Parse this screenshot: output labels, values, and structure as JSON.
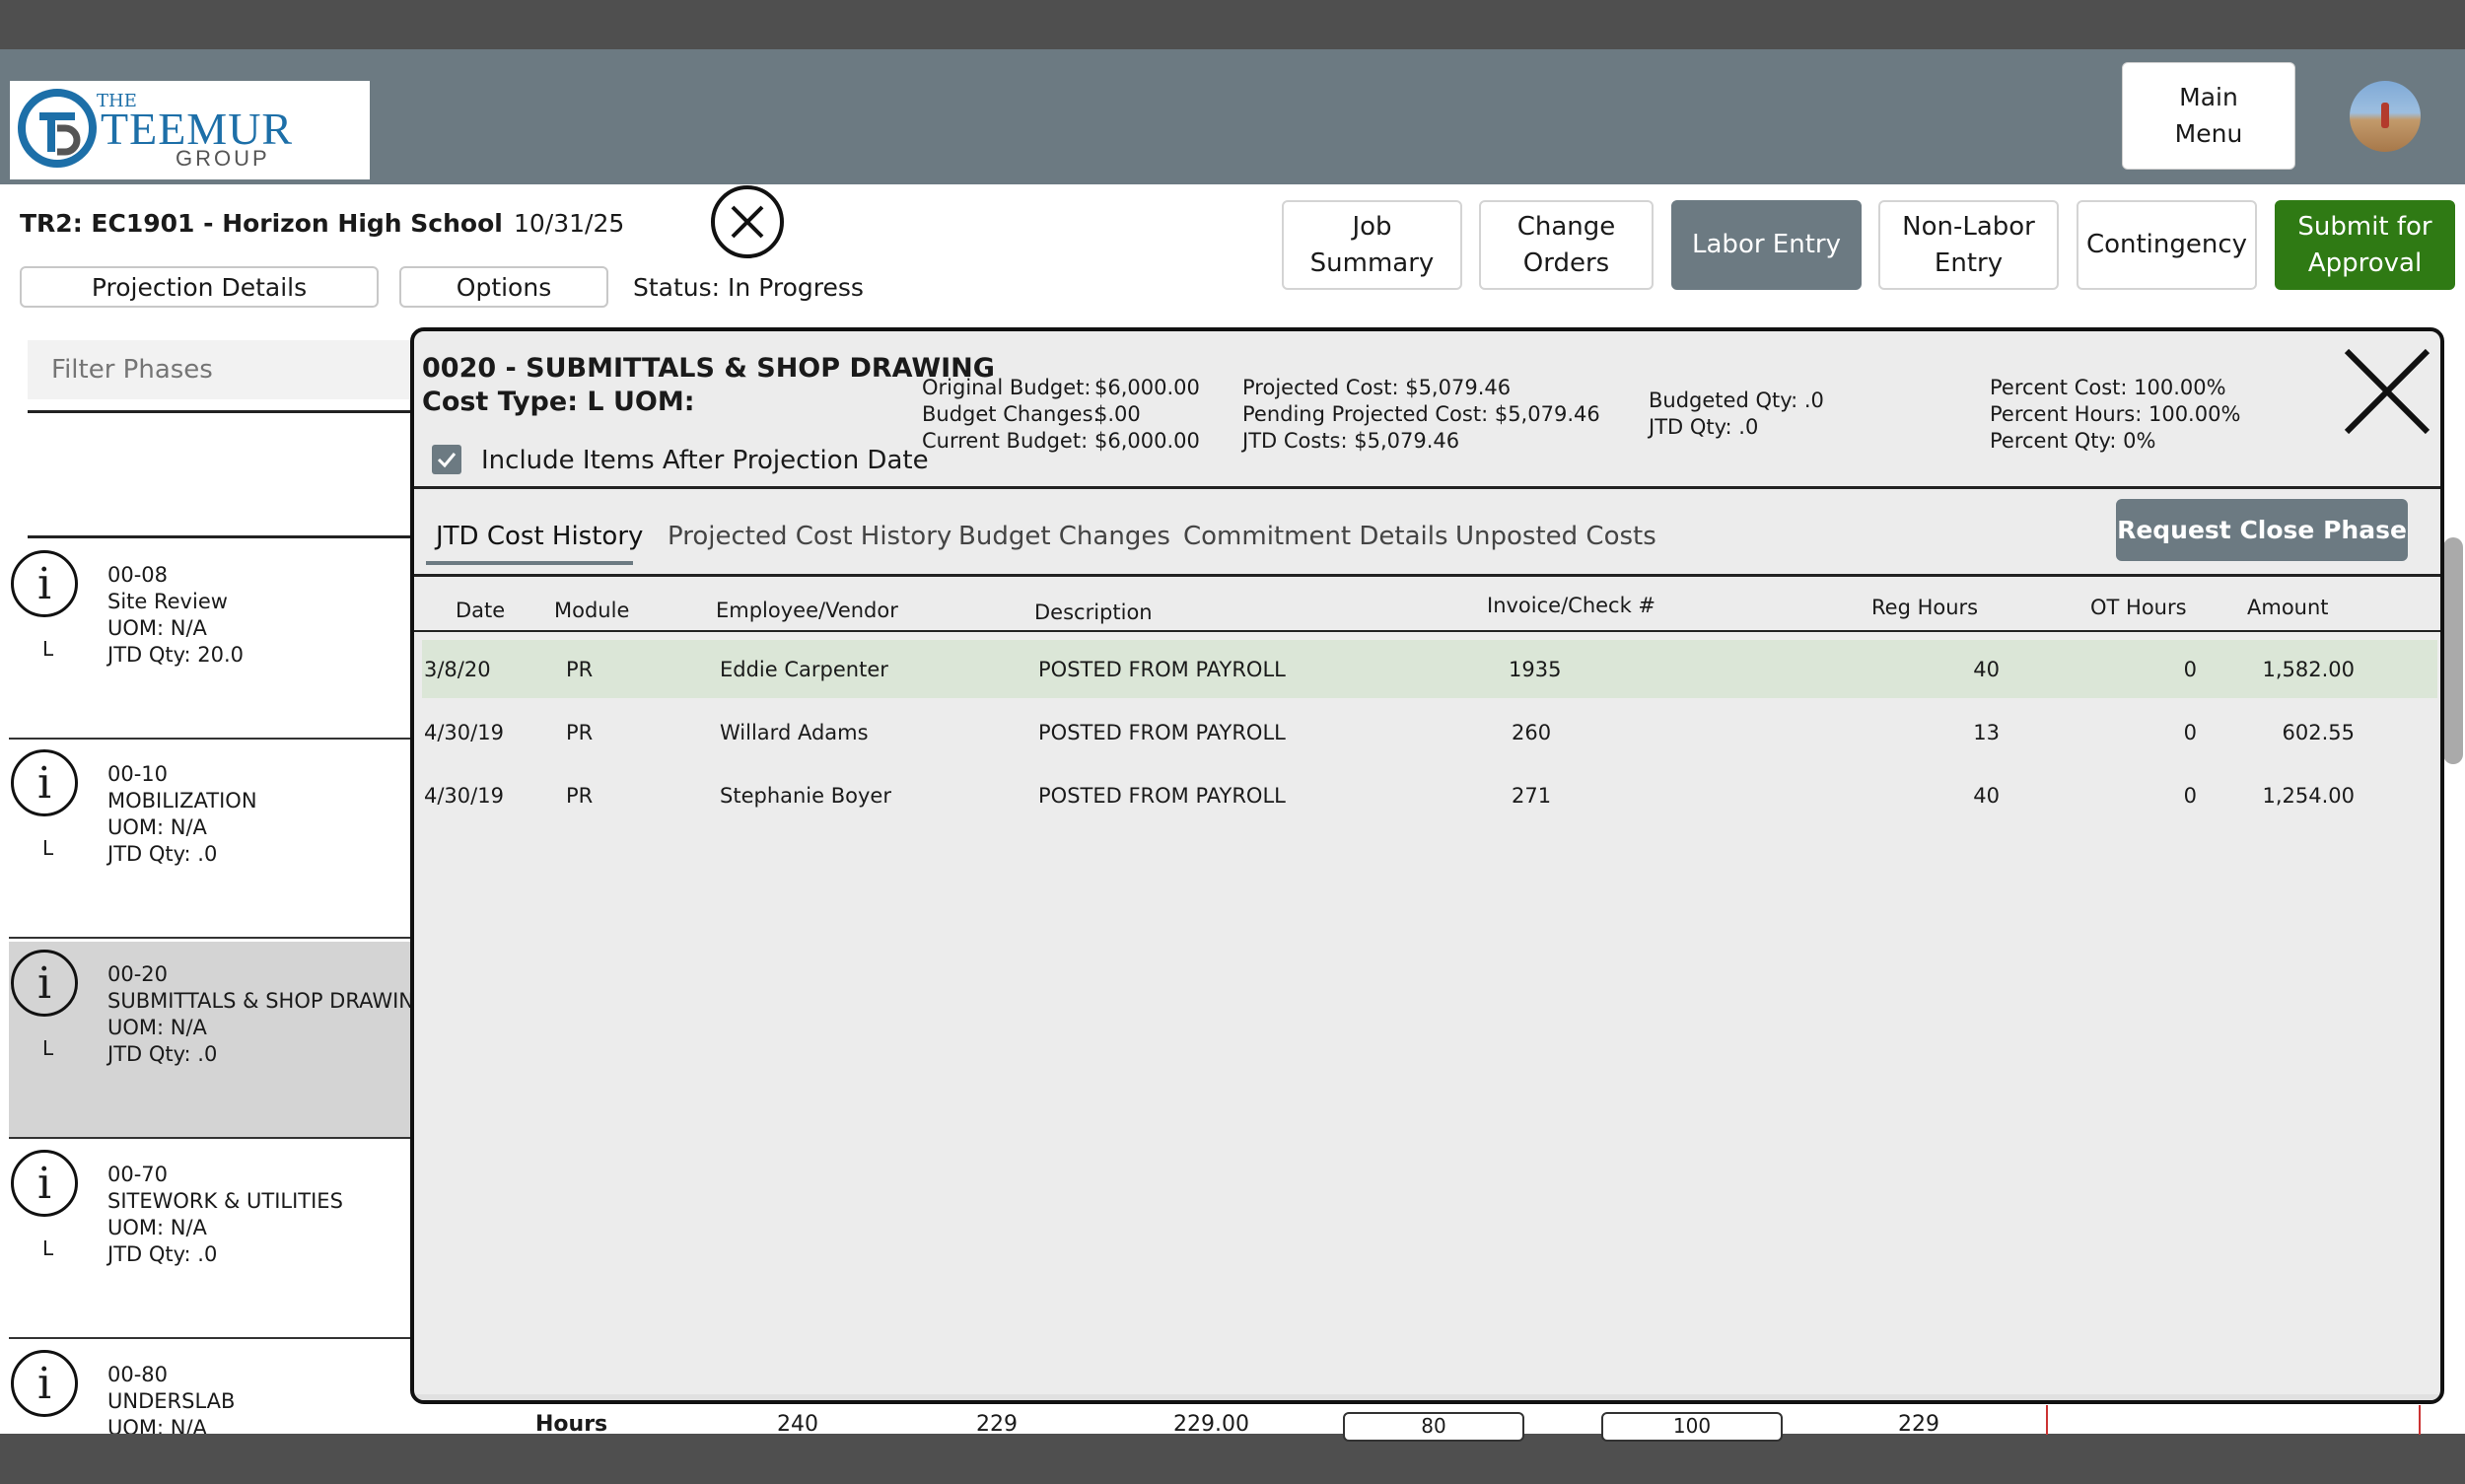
{
  "app": {
    "logo": {
      "the": "THE",
      "name": "TEEMUR",
      "group": "GROUP"
    },
    "main_menu_label": "Main\nMenu"
  },
  "job": {
    "title": "TR2: EC1901 - Horizon High School",
    "date": "10/31/25",
    "status": "Status: In Progress",
    "projection_details_label": "Projection Details",
    "options_label": "Options"
  },
  "nav": {
    "job_summary": "Job\nSummary",
    "change_orders": "Change\nOrders",
    "labor_entry": "Labor Entry",
    "non_labor_entry": "Non-Labor\nEntry",
    "contingency": "Contingency",
    "submit": "Submit for\nApproval"
  },
  "filter": {
    "placeholder": "Filter Phases"
  },
  "phases": [
    {
      "code": "00-08",
      "name": "Site Review",
      "uom": "UOM: N/A",
      "jtd": "JTD Qty: 20.0",
      "type": "L"
    },
    {
      "code": "00-10",
      "name": "MOBILIZATION",
      "uom": "UOM: N/A",
      "jtd": "JTD Qty: .0",
      "type": "L"
    },
    {
      "code": "00-20",
      "name": "SUBMITTALS & SHOP DRAWING",
      "uom": "UOM: N/A",
      "jtd": "JTD Qty: .0",
      "type": "L"
    },
    {
      "code": "00-70",
      "name": "SITEWORK & UTILITIES",
      "uom": "UOM: N/A",
      "jtd": "JTD Qty: .0",
      "type": "L"
    },
    {
      "code": "00-80",
      "name": "UNDERSLAB",
      "uom": "UOM: N/A",
      "jtd": "",
      "type": ""
    }
  ],
  "background_row": {
    "label": "Hours",
    "v1": "240",
    "v2": "229",
    "v3": "229.00",
    "v4": "80",
    "v5": "100",
    "v6": "229"
  },
  "modal": {
    "title": "0020 - SUBMITTALS & SHOP DRAWING",
    "cost_type": "Cost Type: L  UOM:",
    "include_label": "Include Items After Projection Date",
    "include_checked": true,
    "original_budget_label": "Original Budget:",
    "original_budget": "$6,000.00",
    "budget_changes_label": "Budget Changes:",
    "budget_changes": "$.00",
    "current_budget_label": "Current Budget:",
    "current_budget": "$6,000.00",
    "projected_cost": "Projected Cost: $5,079.46",
    "pending_projected_cost": "Pending Projected Cost: $5,079.46",
    "jtd_costs": "JTD Costs: $5,079.46",
    "budgeted_qty": "Budgeted Qty: .0",
    "jtd_qty": "JTD Qty: .0",
    "percent_cost": "Percent Cost: 100.00%",
    "percent_hours": "Percent Hours: 100.00%",
    "percent_qty": "Percent Qty: 0%",
    "tabs": [
      "JTD Cost History",
      "Projected Cost History",
      "Budget Changes",
      "Commitment Details",
      "Unposted Costs"
    ],
    "request_close_label": "Request Close Phase",
    "columns": [
      "Date",
      "Module",
      "Employee/Vendor",
      "Description",
      "Invoice/Check #",
      "Reg Hours",
      "OT Hours",
      "Amount"
    ],
    "rows": [
      {
        "date": "3/8/20",
        "module": "PR",
        "employee": "Eddie Carpenter",
        "description": "POSTED FROM PAYROLL",
        "invoice": "1935",
        "reg": "40",
        "ot": "0",
        "amount": "1,582.00"
      },
      {
        "date": "4/30/19",
        "module": "PR",
        "employee": "Willard Adams",
        "description": "POSTED FROM PAYROLL",
        "invoice": "260",
        "reg": "13",
        "ot": "0",
        "amount": "602.55"
      },
      {
        "date": "4/30/19",
        "module": "PR",
        "employee": "Stephanie Boyer",
        "description": "POSTED FROM PAYROLL",
        "invoice": "271",
        "reg": "40",
        "ot": "0",
        "amount": "1,254.00"
      }
    ]
  },
  "colors": {
    "header": "#6c7a82",
    "accent_green": "#2f7a14",
    "row_highlight": "#dbe6d7",
    "logo_blue": "#1d6fa8"
  },
  "icons": {
    "close": "close-icon",
    "info": "info-icon",
    "check": "check-icon",
    "status_close": "circle-close-icon"
  }
}
